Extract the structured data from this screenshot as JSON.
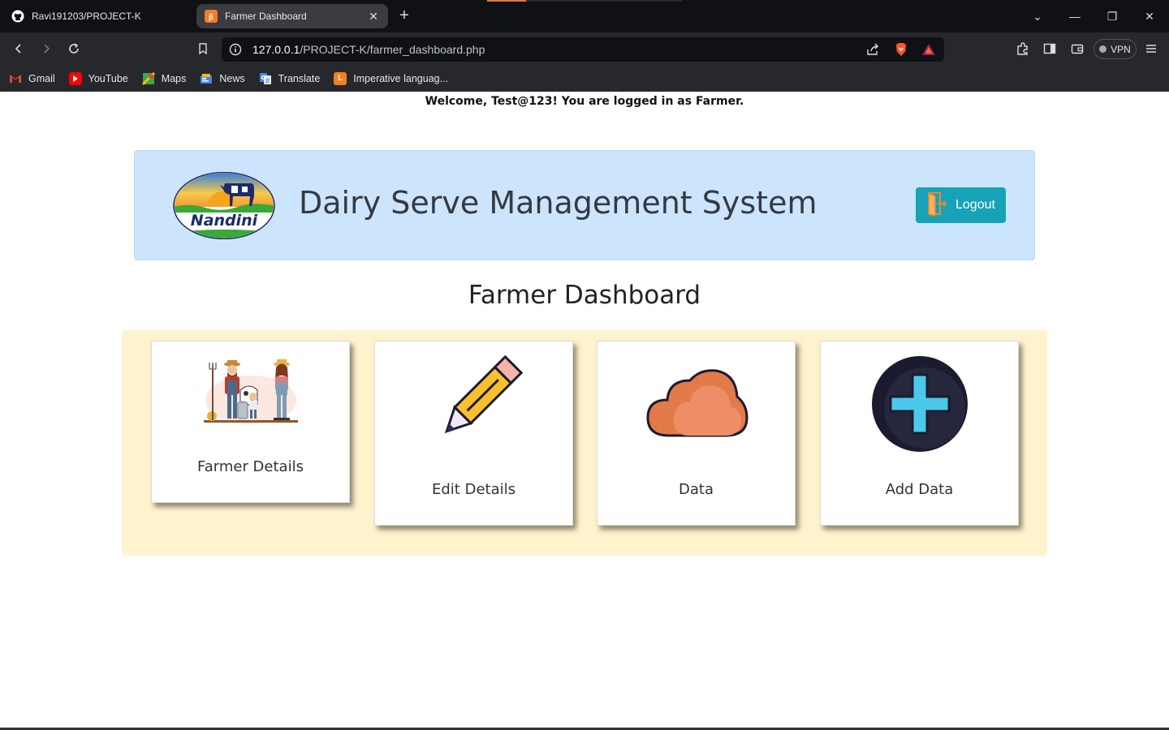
{
  "browser": {
    "tabs": [
      {
        "title": "Ravi191203/PROJECT-K",
        "icon": "github-icon",
        "active": false
      },
      {
        "title": "Farmer Dashboard",
        "icon": "xampp-icon",
        "active": true
      }
    ],
    "url_host": "127.0.0.1",
    "url_path": "/PROJECT-K/farmer_dashboard.php",
    "vpn_label": "VPN",
    "bookmarks": [
      {
        "label": "Gmail",
        "icon": "gmail-icon"
      },
      {
        "label": "YouTube",
        "icon": "youtube-icon"
      },
      {
        "label": "Maps",
        "icon": "maps-icon"
      },
      {
        "label": "News",
        "icon": "news-icon"
      },
      {
        "label": "Translate",
        "icon": "translate-icon"
      },
      {
        "label": "Imperative languag...",
        "icon": "bookmark-l-icon"
      }
    ]
  },
  "page": {
    "welcome": "Welcome, Test@123! You are logged in as Farmer.",
    "system_name": "Dairy Serve Management System",
    "logo_text": "Nandini",
    "logout_label": "Logout",
    "dashboard_title": "Farmer Dashboard",
    "cards": [
      {
        "label": "Farmer Details",
        "icon": "farmer-family-icon"
      },
      {
        "label": "Edit Details",
        "icon": "pencil-icon"
      },
      {
        "label": "Data",
        "icon": "cloud-icon"
      },
      {
        "label": "Add Data",
        "icon": "plus-circle-icon"
      }
    ]
  },
  "colors": {
    "header_bg": "#cce5fd",
    "panel_bg": "#fff3cd",
    "logout_bg": "#17a2b8"
  }
}
